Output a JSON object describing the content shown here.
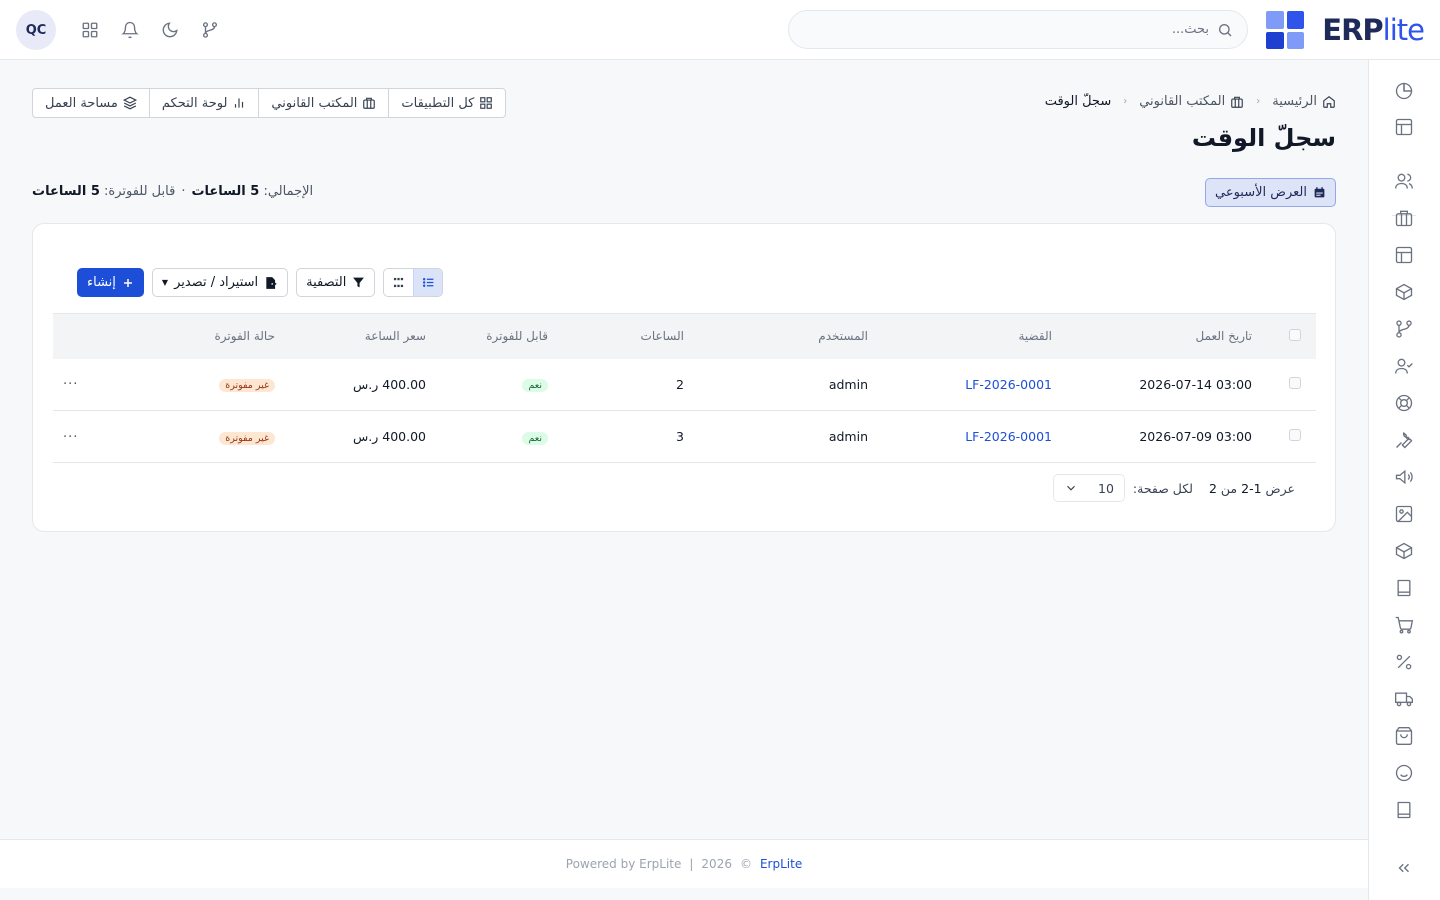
{
  "app": {
    "brand_main": "ERP",
    "brand_suffix": "lite",
    "brand_colors": [
      "#2f54eb",
      "#6f8ff7",
      "#1e3fd0",
      "#2f54eb"
    ]
  },
  "header": {
    "search_placeholder": "بحث...",
    "avatar_initials": "QC",
    "icons": [
      "grid-icon",
      "bell-icon",
      "moon-icon",
      "git-branch-icon"
    ]
  },
  "sidebar": {
    "icons": [
      "pie-chart-icon",
      "layout-icon",
      "users-icon",
      "briefcase-icon",
      "layout-icon",
      "package-icon",
      "git-branch-icon",
      "user-check-icon",
      "life-buoy-icon",
      "wrench-icon",
      "megaphone-icon",
      "image-icon",
      "box-icon",
      "book-icon",
      "cart-icon",
      "percent-icon",
      "truck-icon",
      "shopping-bag-icon",
      "smile-icon",
      "book-icon"
    ]
  },
  "breadcrumb": {
    "home": "الرئيسية",
    "parent": "المكتب القانوني",
    "current": "سجلّ الوقت"
  },
  "page": {
    "title": "سجلّ الوقت"
  },
  "quick_links": {
    "all_apps": "كل التطبيقات",
    "legal_office": "المكتب القانوني",
    "dashboard": "لوحة التحكم",
    "workspace": "مساحة العمل"
  },
  "weekly_view": {
    "label": "العرض الأسبوعي"
  },
  "summary": {
    "total_label": "الإجمالي:",
    "total_value": "5 الساعات",
    "dot": "·",
    "billable_label": "قابل للفوترة:",
    "billable_value": "5 الساعات"
  },
  "toolbar": {
    "create": "إنشاء",
    "import_export": "استيراد / تصدير",
    "filter": "التصفية"
  },
  "table": {
    "columns": [
      "تاريخ العمل",
      "القضية",
      "المستخدم",
      "الساعات",
      "قابل للفوترة",
      "سعر الساعة",
      "حالة الفوترة"
    ],
    "rows": [
      {
        "date": "2026-07-14 03:00",
        "case": "LF-2026-0001",
        "user": "admin",
        "hours": "2",
        "billable": "نعم",
        "rate": "400.00 ر.س",
        "status": "غير مفوترة"
      },
      {
        "date": "2026-07-09 03:00",
        "case": "LF-2026-0001",
        "user": "admin",
        "hours": "3",
        "billable": "نعم",
        "rate": "400.00 ر.س",
        "status": "غير مفوترة"
      }
    ],
    "more": "···"
  },
  "pager": {
    "showing": "عرض",
    "range": "1-2",
    "of": "من",
    "total": "2",
    "per_page_label": "لكل صفحة:",
    "per_page": "10"
  },
  "footer": {
    "copyright": "©",
    "year": "2026",
    "brand": "ErpLite",
    "powered": "Powered by ErpLite",
    "divider": "|"
  }
}
